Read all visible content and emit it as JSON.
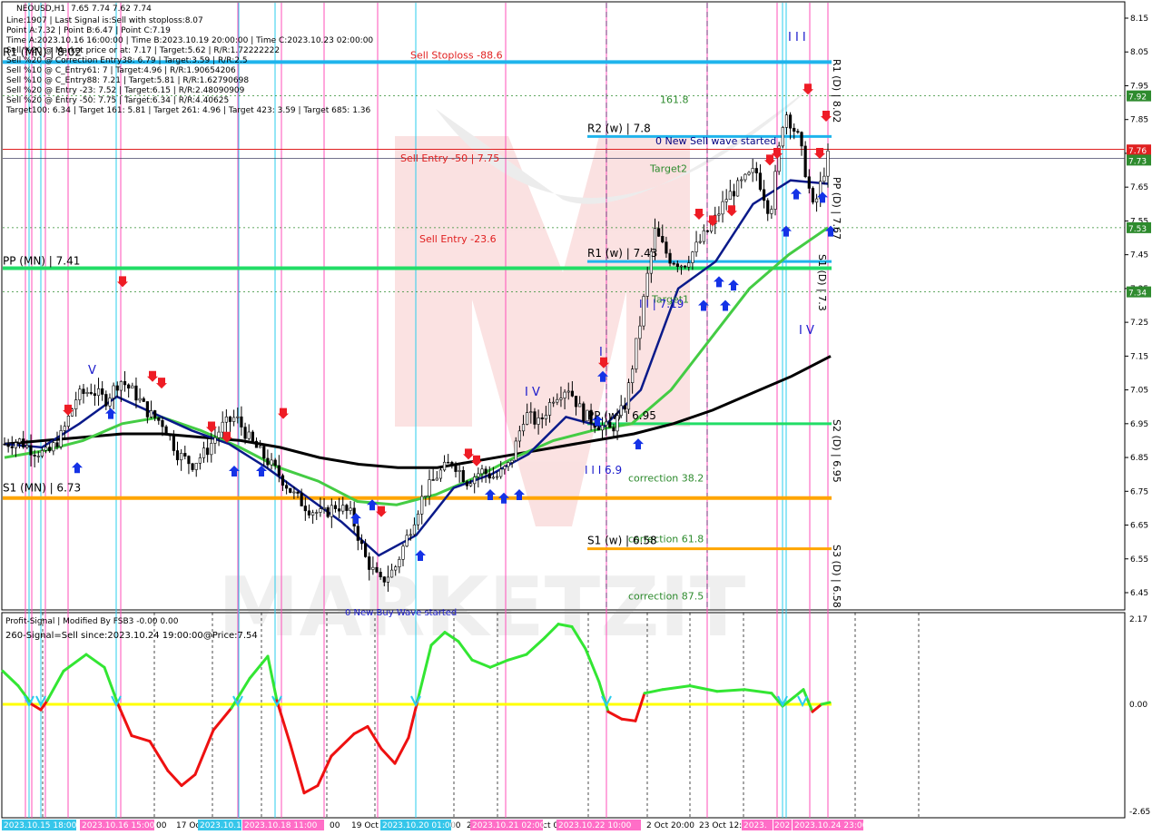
{
  "window": {
    "title": "NEOUSD,H1"
  },
  "header": {
    "ohlc": "7.65 7.74 7.62 7.74",
    "lines": [
      "Line:1907 | Last Signal is:Sell with stoploss:8.07",
      "Point A:7.32 | Point B:6.47 | Point C:7.19",
      "Time A:2023.10.16 16:00:00 | Time B:2023.10.19 20:00:00 | Time C:2023.10.23 02:00:00",
      "Sell %20 @ Market price or at: 7.17 | Target:5.62 | R/R:1.72222222",
      "Sell %20 @ Correction Entry38: 6.79 | Target:3.59 | R/R:2.5",
      "Sell %10 @ C_Entry61: 7 | Target:4.96 | R/R:1.90654206",
      "Sell %10 @ C_Entry88: 7.21 | Target:5.81 | R/R:1.62790698",
      "Sell %20 @ Entry -23: 7.52 | Target:6.15 | R/R:2.48090909",
      "Sell %20 @ Entry -50: 7.75 | Target:6.34 | R/R:4.40625",
      "Target100: 6.34 | Target 161: 5.81 | Target 261: 4.96 | Target 423: 3.59 | Target 685: 1.36"
    ]
  },
  "levels": [
    {
      "label": "Sell Stoploss -88.6",
      "price": 8.02,
      "color": "#e02020"
    },
    {
      "label": "161.8",
      "price": 7.92,
      "color": "#2e8b2e"
    },
    {
      "label": "0 New Sell wave started",
      "price": 7.79,
      "color": "#000080"
    },
    {
      "label": "Sell Entry -50 | 7.75",
      "price": 7.75,
      "color": "#e02020"
    },
    {
      "label": "Target2",
      "price": 7.73,
      "color": "#2e8b2e"
    },
    {
      "label": "Sell Entry -23.6",
      "price": 7.53,
      "color": "#e02020"
    },
    {
      "label": "Target1",
      "price": 7.34,
      "color": "#2e8b2e"
    },
    {
      "label": "correction 38.2",
      "price": 6.79,
      "color": "#2e8b2e"
    },
    {
      "label": "correction 61.8",
      "price": 6.61,
      "color": "#2e8b2e"
    },
    {
      "label": "correction 87.5",
      "price": 6.44,
      "color": "#2e8b2e"
    }
  ],
  "pivots": [
    {
      "label": "R1 (MN) | 8.02",
      "price": 8.02,
      "color": "#1fb4ec"
    },
    {
      "label": "PP (MN) | 7.41",
      "price": 7.41,
      "color": "#22dd66"
    },
    {
      "label": "S1 (MN) | 6.73",
      "price": 6.73,
      "color": "#ffa500"
    },
    {
      "label": "R2 (w) | 7.8",
      "price": 7.8,
      "color": "#1fb4ec"
    },
    {
      "label": "R1 (w) | 7.43",
      "price": 7.43,
      "color": "#1fb4ec"
    },
    {
      "label": "PP (w) | 6.95",
      "price": 6.95,
      "color": "#22dd66"
    },
    {
      "label": "S1 (w) | 6.58",
      "price": 6.58,
      "color": "#ffa500"
    }
  ],
  "vertical_labels": [
    "R1 (D) | 8.02",
    "PP (D) | 7.67",
    "S1 (D) | 7.3",
    "S2 (D) | 6.95",
    "S3 (D) | 6.58"
  ],
  "wave_labels": [
    "I I I",
    "I I | 7.19",
    "I V",
    "I",
    "I V",
    "V",
    "I I I 6.9",
    "0 New Buy Wave started"
  ],
  "price_tags": [
    {
      "text": "7.92",
      "price": 7.92,
      "bg": "#2e8b2e"
    },
    {
      "text": "7.76",
      "price": 7.76,
      "bg": "#e02020"
    },
    {
      "text": "7.73",
      "price": 7.73,
      "bg": "#2e8b2e"
    },
    {
      "text": "7.53",
      "price": 7.53,
      "bg": "#2e8b2e"
    },
    {
      "text": "7.34",
      "price": 7.34,
      "bg": "#2e8b2e"
    }
  ],
  "indicator": {
    "title": "Profit-Signal | Modified By FSB3 -0.00 0.00",
    "signal": "260-Signal=Sell since:2023.10.24 19:00:00@Price:7.54",
    "scale": [
      "2.17",
      "0.00",
      "-2.65"
    ]
  },
  "time_axis": {
    "plain": [
      "00",
      "17 Oc",
      "00",
      "19 Oct",
      "00",
      "2",
      "ct 07:0",
      "2 Oct 20:00",
      "23 Oct 12:"
    ],
    "highlighted": [
      "2023.10.15 18:00",
      "2023.10.16 15:00",
      "2023.10.1",
      "2023.10.18 11:00",
      "2023.10.20 01:00",
      "2023.10.21 02:00",
      "2023.10.22 10:00",
      "2023.",
      "202",
      "2023.10.24 23:00"
    ]
  },
  "chart_data": {
    "type": "candlestick",
    "title": "NEOUSD,H1",
    "ylim": [
      6.4,
      8.2
    ],
    "y_ticks": [
      "8.15",
      "8.05",
      "7.95",
      "7.85",
      "7.75",
      "7.65",
      "7.55",
      "7.45",
      "7.35",
      "7.25",
      "7.15",
      "7.05",
      "6.95",
      "6.85",
      "6.75",
      "6.65",
      "6.55",
      "6.45"
    ],
    "close_path": [
      6.89,
      6.9,
      6.87,
      6.86,
      6.92,
      7.03,
      7.05,
      7.02,
      7.08,
      7.04,
      6.98,
      6.95,
      6.86,
      6.83,
      6.87,
      6.94,
      6.97,
      6.9,
      6.85,
      6.8,
      6.74,
      6.7,
      6.68,
      6.71,
      6.68,
      6.55,
      6.48,
      6.52,
      6.63,
      6.74,
      6.8,
      6.84,
      6.78,
      6.81,
      6.79,
      6.83,
      6.98,
      6.95,
      7.03,
      7.06,
      6.98,
      6.95,
      6.93,
      7.01,
      7.25,
      7.52,
      7.44,
      7.42,
      7.48,
      7.54,
      7.62,
      7.66,
      7.7,
      7.57,
      7.88,
      7.79,
      7.58,
      7.74
    ],
    "ma_slow": [
      6.89,
      6.9,
      6.91,
      6.92,
      6.92,
      6.91,
      6.9,
      6.88,
      6.85,
      6.83,
      6.82,
      6.82,
      6.84,
      6.86,
      6.88,
      6.9,
      6.92,
      6.95,
      6.99,
      7.04,
      7.09,
      7.15
    ],
    "ma_mid": [
      6.85,
      6.87,
      6.9,
      6.95,
      6.97,
      6.93,
      6.88,
      6.82,
      6.78,
      6.72,
      6.71,
      6.74,
      6.79,
      6.85,
      6.9,
      6.93,
      6.95,
      7.05,
      7.2,
      7.35,
      7.45,
      7.53
    ],
    "ma_fast": [
      6.89,
      6.88,
      6.95,
      7.03,
      6.98,
      6.93,
      6.89,
      6.82,
      6.74,
      6.66,
      6.56,
      6.62,
      6.76,
      6.8,
      6.86,
      6.97,
      6.94,
      7.05,
      7.35,
      7.43,
      7.6,
      7.67,
      7.66
    ],
    "oscillator": {
      "ylim": [
        -2.65,
        2.17
      ],
      "zero": 0.0
    }
  }
}
